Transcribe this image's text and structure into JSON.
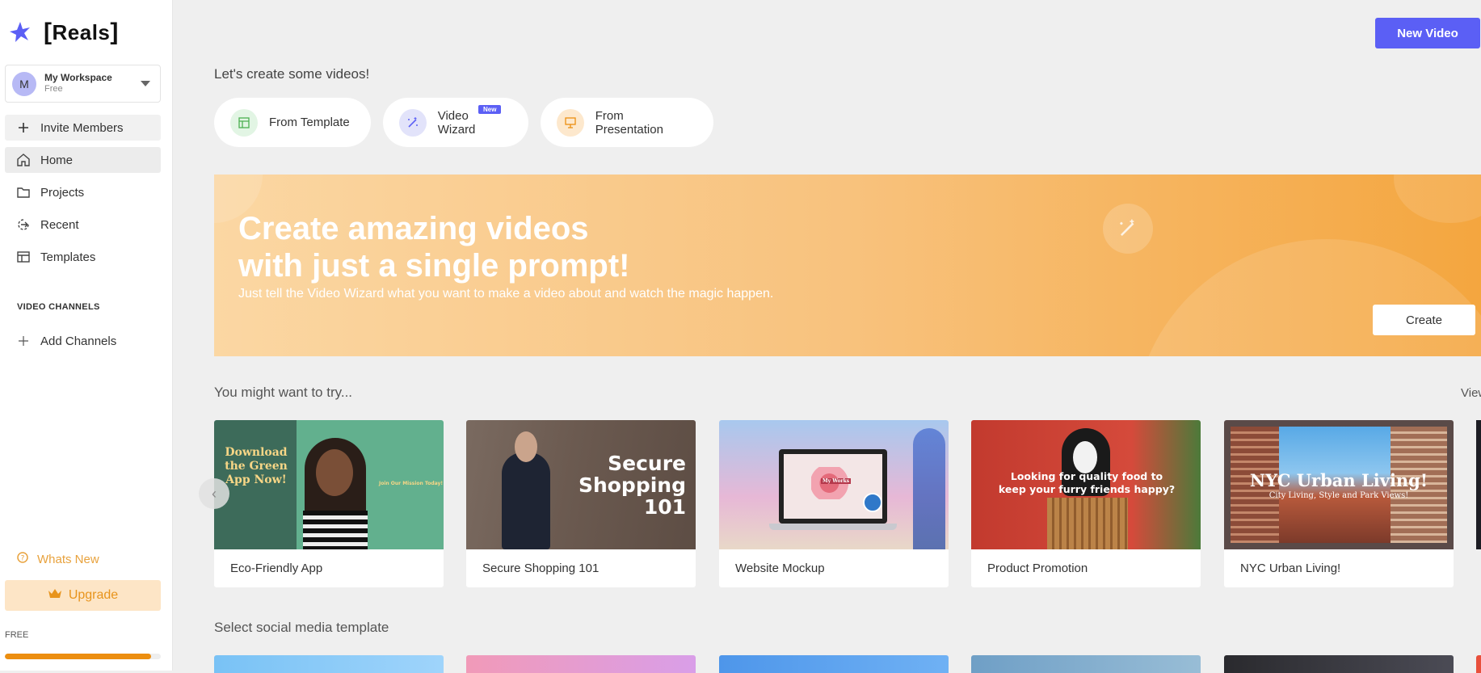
{
  "app": {
    "brand": "Reals"
  },
  "workspace": {
    "avatar_letter": "M",
    "name": "My Workspace",
    "plan": "Free"
  },
  "sidebar": {
    "invite_label": "Invite Members",
    "items": [
      {
        "label": "Home",
        "icon": "home-icon"
      },
      {
        "label": "Projects",
        "icon": "folder-icon"
      },
      {
        "label": "Recent",
        "icon": "recent-icon"
      },
      {
        "label": "Templates",
        "icon": "templates-icon"
      }
    ],
    "channels_section": "VIDEO CHANNELS",
    "add_channels_label": "Add Channels",
    "whats_new_label": "Whats New",
    "upgrade_label": "Upgrade",
    "plan_label": "FREE",
    "usage_fraction": 0.94
  },
  "header": {
    "new_video_label": "New Video"
  },
  "main": {
    "intro": "Let's create some videos!",
    "quick_actions": [
      {
        "label": "From Template",
        "icon": "template-icon"
      },
      {
        "label": "Video Wizard",
        "icon": "magic-wand-icon",
        "badge": "New"
      },
      {
        "label": "From Presentation",
        "icon": "presentation-icon"
      }
    ],
    "banner": {
      "title_line1": "Create amazing videos",
      "title_line2": "with just a single prompt!",
      "subtitle": "Just tell the Video Wizard what you want to make a video about and watch the magic happen.",
      "button": "Create"
    },
    "try_title": "You might want to try...",
    "view_link": "View",
    "cards": [
      {
        "label": "Eco-Friendly App",
        "thumb_text": "Download the Green App Now!",
        "thumb_sub": "Join Our Mission Today!"
      },
      {
        "label": "Secure Shopping 101",
        "thumb_text": "Secure Shopping 101"
      },
      {
        "label": "Website Mockup",
        "thumb_text": "My Works"
      },
      {
        "label": "Product Promotion",
        "thumb_text": "Looking for quality food to keep your furry friends happy?"
      },
      {
        "label": "NYC Urban Living!",
        "thumb_text": "NYC Urban Living!",
        "thumb_sub": "City Living, Style and Park Views!"
      }
    ],
    "social_title": "Select social media template"
  },
  "colors": {
    "accent": "#5b5ff5",
    "upgrade_bg": "#fde5c6",
    "upgrade_text": "#e8941c",
    "progress": "#ec8e10"
  }
}
